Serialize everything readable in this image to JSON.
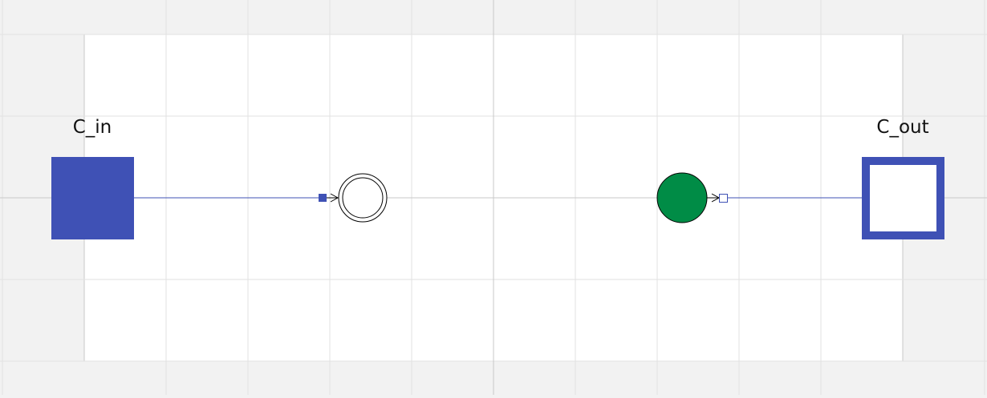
{
  "diagram": {
    "ports": {
      "input": {
        "label": "C_in",
        "kind": "connector-input"
      },
      "output": {
        "label": "C_out",
        "kind": "connector-output"
      }
    },
    "nodes": {
      "left_node": {
        "kind": "double-circle-node",
        "fill": "#ffffff"
      },
      "right_node": {
        "kind": "filled-circle-node"
      }
    },
    "connections": [
      {
        "from": "input",
        "to": "left_node",
        "arrow": "open",
        "end_marker": "filled-square"
      },
      {
        "from": "right_node",
        "to": "output",
        "arrow": "open",
        "start_marker": "hollow-square"
      }
    ]
  },
  "colors": {
    "background": "#f2f2f2",
    "canvas": "#ffffff",
    "grid": "#e2e2e2",
    "axis": "#c8c8c8",
    "port_blue": "#3f51b5",
    "node_green": "#008c46",
    "stroke": "#000000"
  }
}
